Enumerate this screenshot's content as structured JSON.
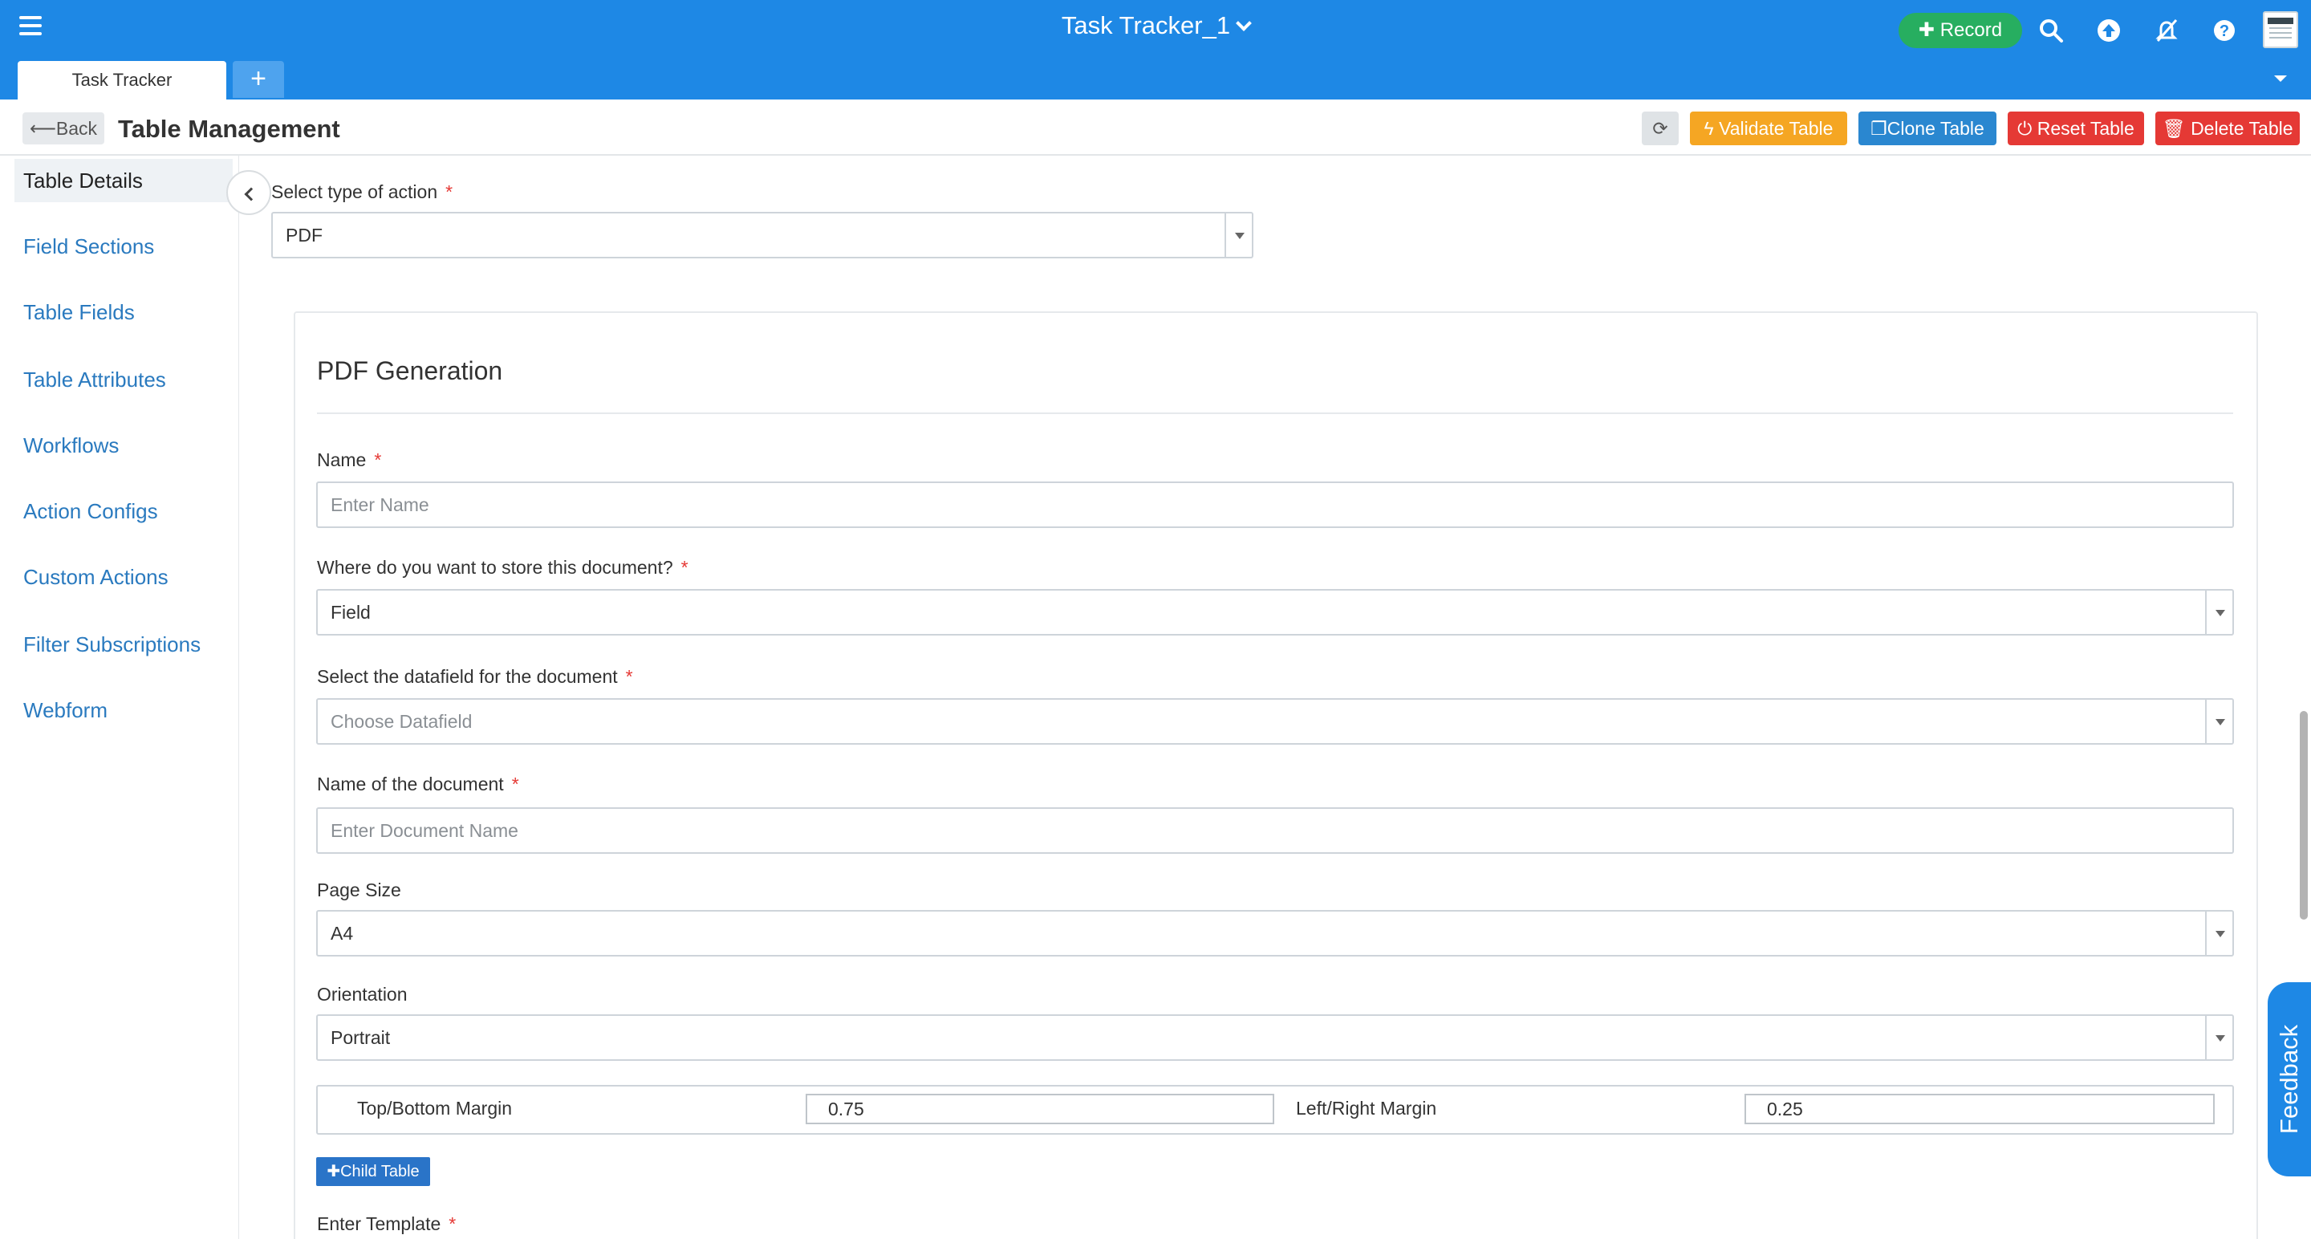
{
  "app": {
    "title": "Task Tracker_1",
    "record_label": "Record"
  },
  "tabs": [
    {
      "label": "Task Tracker"
    }
  ],
  "tab_add_label": "+",
  "header": {
    "back_label": "Back",
    "page_title": "Table Management",
    "buttons": {
      "validate": "Validate Table",
      "clone": "Clone Table",
      "reset": "Reset Table",
      "delete": "Delete Table"
    }
  },
  "sidebar": {
    "items": [
      {
        "label": "Table Details",
        "active": true
      },
      {
        "label": "Field Sections"
      },
      {
        "label": "Table Fields"
      },
      {
        "label": "Table Attributes"
      },
      {
        "label": "Workflows"
      },
      {
        "label": "Action Configs"
      },
      {
        "label": "Custom Actions"
      },
      {
        "label": "Filter Subscriptions"
      },
      {
        "label": "Webform"
      }
    ]
  },
  "form": {
    "action_type": {
      "label": "Select type of action",
      "value": "PDF"
    },
    "section_title": "PDF Generation",
    "name": {
      "label": "Name",
      "placeholder": "Enter Name"
    },
    "store": {
      "label": "Where do you want to store this document?",
      "value": "Field"
    },
    "datafield": {
      "label": "Select the datafield for the document",
      "placeholder": "Choose Datafield"
    },
    "doc_name": {
      "label": "Name of the document",
      "placeholder": "Enter Document Name"
    },
    "page_size": {
      "label": "Page Size",
      "value": "A4"
    },
    "orientation": {
      "label": "Orientation",
      "value": "Portrait"
    },
    "margins": {
      "top_bottom_label": "Top/Bottom Margin",
      "top_bottom_value": "0.75",
      "left_right_label": "Left/Right Margin",
      "left_right_value": "0.25"
    },
    "child_table_label": "Child Table",
    "template_label": "Enter Template",
    "required_mark": "*"
  },
  "feedback_label": "Feedback",
  "colors": {
    "topbar": "#1e88e5",
    "record": "#27ae60",
    "validate": "#f5a623",
    "clone": "#2a87d0",
    "danger": "#e53935",
    "link": "#2a7abf"
  }
}
